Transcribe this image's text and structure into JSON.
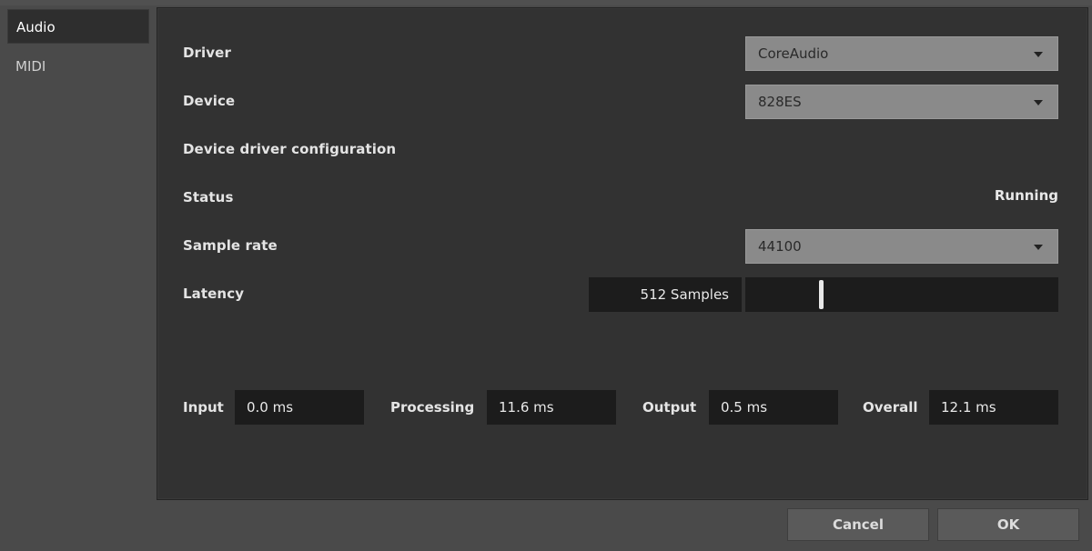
{
  "sidebar": {
    "items": [
      {
        "label": "Audio",
        "active": true
      },
      {
        "label": "MIDI",
        "active": false
      }
    ]
  },
  "audio": {
    "driver": {
      "label": "Driver",
      "value": "CoreAudio"
    },
    "device": {
      "label": "Device",
      "value": "828ES"
    },
    "device_driver_config": {
      "label": "Device driver configuration"
    },
    "status": {
      "label": "Status",
      "value": "Running"
    },
    "sample_rate": {
      "label": "Sample rate",
      "value": "44100"
    },
    "latency": {
      "label": "Latency",
      "value": "512 Samples",
      "slider_fraction": 0.24
    }
  },
  "metrics": {
    "input": {
      "label": "Input",
      "value": "0.0 ms"
    },
    "processing": {
      "label": "Processing",
      "value": "11.6 ms"
    },
    "output": {
      "label": "Output",
      "value": "0.5 ms"
    },
    "overall": {
      "label": "Overall",
      "value": "12.1 ms"
    }
  },
  "footer": {
    "cancel_label": "Cancel",
    "ok_label": "OK"
  }
}
